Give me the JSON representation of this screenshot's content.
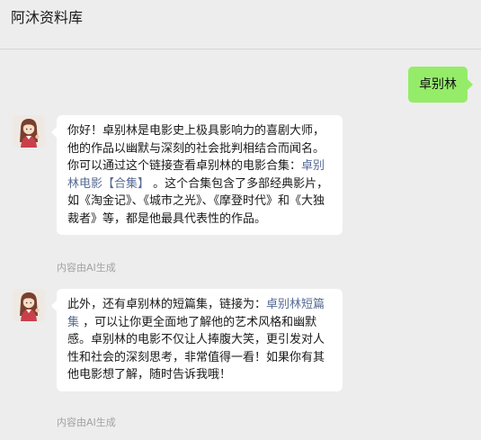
{
  "header": {
    "title": "阿沐资料库"
  },
  "user_message": {
    "text": "卓别林"
  },
  "messages": [
    {
      "text_before": "你好！卓别林是电影史上极具影响力的喜剧大师，他的作品以幽默与深刻的社会批判相结合而闻名。你可以通过这个链接查看卓别林的电影合集：",
      "link_text": "卓别林电影【合集】",
      "text_after": " 。这个合集包含了多部经典影片，如《淘金记》、《城市之光》、《摩登时代》和《大独裁者》等，都是他最具代表性的作品。",
      "ai_note": "内容由AI生成"
    },
    {
      "text_before": "此外，还有卓别林的短篇集，链接为：",
      "link_text": "卓别林短篇集",
      "text_after": " ，可以让你更全面地了解他的艺术风格和幽默感。卓别林的电影不仅让人捧腹大笑，更引发对人性和社会的深刻思考，非常值得一看！如果你有其他电影想了解，随时告诉我哦！",
      "ai_note": "内容由AI生成"
    }
  ],
  "colors": {
    "background": "#ededed",
    "user_bubble": "#95ec69",
    "bot_bubble": "#ffffff",
    "link": "#576b95",
    "note": "#a3a3a3"
  },
  "icons": {
    "bot_avatar": "girl-avatar-icon"
  }
}
